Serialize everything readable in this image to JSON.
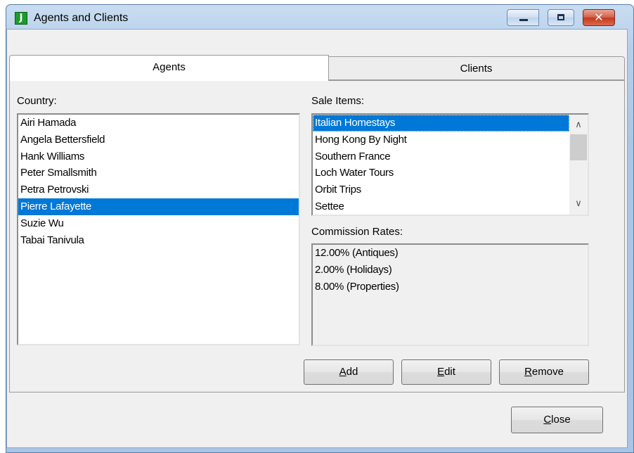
{
  "window": {
    "title": "Agents and Clients",
    "app_icon_letter": "J"
  },
  "tabs": [
    {
      "label": "Agents",
      "selected": true
    },
    {
      "label": "Clients",
      "selected": false
    }
  ],
  "agents_panel": {
    "country_label": "Country:",
    "agents": [
      "Airi Hamada",
      "Angela Bettersfield",
      "Hank Williams",
      "Peter Smallsmith",
      "Petra Petrovski",
      "Pierre Lafayette",
      "Suzie Wu",
      "Tabai Tanivula"
    ],
    "selected_agent": "Pierre Lafayette",
    "sale_items_label": "Sale Items:",
    "sale_items": [
      "Italian Homestays",
      "Hong Kong By Night",
      "Southern France",
      "Loch Water Tours",
      "Orbit Trips",
      "Settee"
    ],
    "selected_sale_item": "Italian Homestays",
    "commission_rates_label": "Commission Rates:",
    "commission_rates": [
      "12.00% (Antiques)",
      "2.00% (Holidays)",
      "8.00% (Properties)"
    ]
  },
  "buttons": {
    "add": {
      "mnemonic": "A",
      "rest": "dd"
    },
    "edit": {
      "mnemonic": "E",
      "rest": "dit"
    },
    "remove": {
      "mnemonic": "R",
      "rest": "emove"
    },
    "close": {
      "mnemonic": "C",
      "rest": "lose"
    }
  },
  "colors": {
    "selection": "#0078d7",
    "title_bar": "#b6cfea",
    "close_button": "#c5391f"
  }
}
